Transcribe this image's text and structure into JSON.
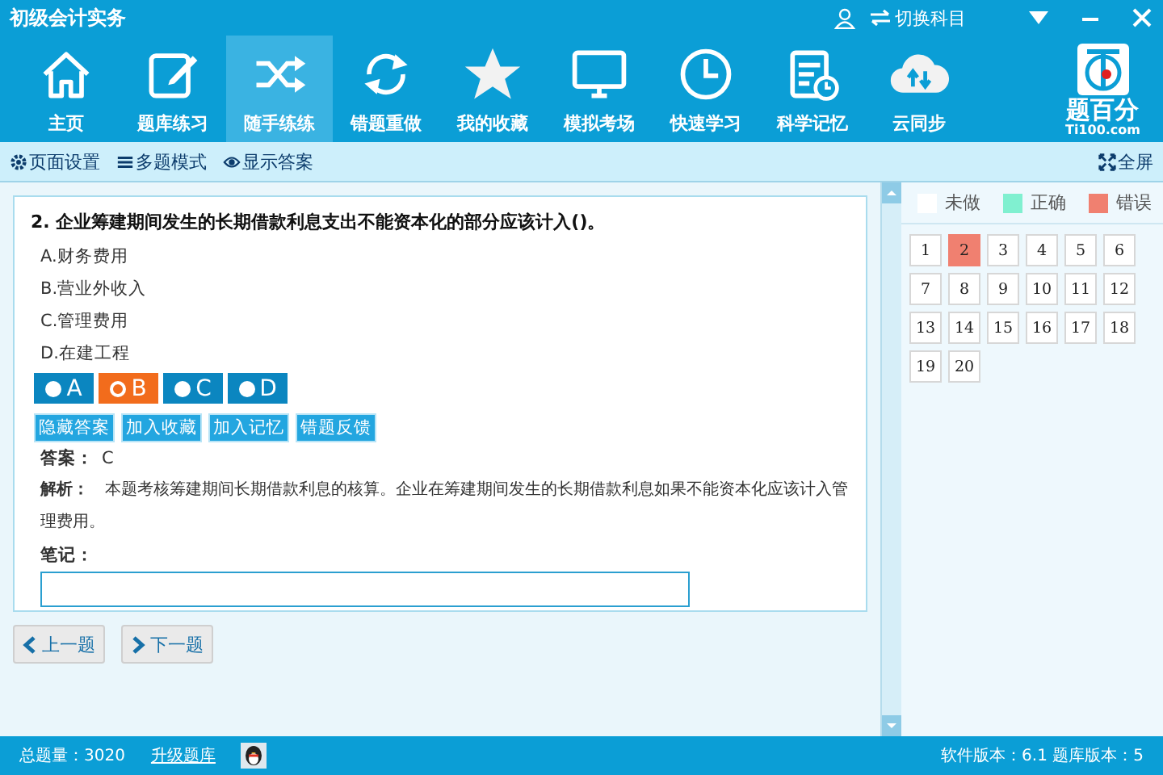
{
  "window": {
    "title": "初级会计实务",
    "switch_subject": "切换科目"
  },
  "nav": [
    {
      "label": "主页",
      "selected": false
    },
    {
      "label": "题库练习",
      "selected": false
    },
    {
      "label": "随手练练",
      "selected": true
    },
    {
      "label": "错题重做",
      "selected": false
    },
    {
      "label": "我的收藏",
      "selected": false
    },
    {
      "label": "模拟考场",
      "selected": false
    },
    {
      "label": "快速学习",
      "selected": false
    },
    {
      "label": "科学记忆",
      "selected": false
    },
    {
      "label": "云同步",
      "selected": false
    }
  ],
  "logo": {
    "name": "题百分",
    "site": "Ti100.com"
  },
  "toolbar": {
    "items": [
      "页面设置",
      "多题模式",
      "显示答案"
    ],
    "fullscreen": "全屏"
  },
  "question": {
    "title": "2. 企业筹建期间发生的长期借款利息支出不能资本化的部分应该计入()。",
    "options": [
      "A.财务费用",
      "B.营业外收入",
      "C.管理费用",
      "D.在建工程"
    ],
    "choices": [
      {
        "label": "A",
        "selected": false
      },
      {
        "label": "B",
        "selected": true
      },
      {
        "label": "C",
        "selected": false
      },
      {
        "label": "D",
        "selected": false
      }
    ],
    "actions": [
      "隐藏答案",
      "加入收藏",
      "加入记忆",
      "错题反馈"
    ],
    "answer_label": "答案：",
    "answer": "C",
    "analysis_label": "解析：",
    "analysis": "本题考核筹建期间长期借款利息的核算。企业在筹建期间发生的长期借款利息如果不能资本化应该计入管理费用。",
    "notes_label": "笔记："
  },
  "pager": {
    "prev": "上一题",
    "next": "下一题"
  },
  "legend": [
    {
      "label": "未做",
      "color": "#ffffff"
    },
    {
      "label": "正确",
      "color": "#80f0d0"
    },
    {
      "label": "错误",
      "color": "#f08070"
    }
  ],
  "grid": [
    {
      "label": "1",
      "kind": "undone"
    },
    {
      "label": "2",
      "kind": "wrong"
    },
    {
      "label": "3",
      "kind": "undone"
    },
    {
      "label": "4",
      "kind": "undone"
    },
    {
      "label": "5",
      "kind": "undone"
    },
    {
      "label": "6",
      "kind": "undone"
    },
    {
      "label": "7",
      "kind": "undone"
    },
    {
      "label": "8",
      "kind": "undone"
    },
    {
      "label": "9",
      "kind": "undone"
    },
    {
      "label": "10",
      "kind": "undone"
    },
    {
      "label": "11",
      "kind": "undone"
    },
    {
      "label": "12",
      "kind": "undone"
    },
    {
      "label": "13",
      "kind": "undone"
    },
    {
      "label": "14",
      "kind": "undone"
    },
    {
      "label": "15",
      "kind": "undone"
    },
    {
      "label": "16",
      "kind": "undone"
    },
    {
      "label": "17",
      "kind": "undone"
    },
    {
      "label": "18",
      "kind": "undone"
    },
    {
      "label": "19",
      "kind": "undone"
    },
    {
      "label": "20",
      "kind": "undone"
    }
  ],
  "status_bar": {
    "total": "总题量：3020",
    "upgrade": "升级题库",
    "version": "软件版本：6.1  题库版本：5"
  }
}
